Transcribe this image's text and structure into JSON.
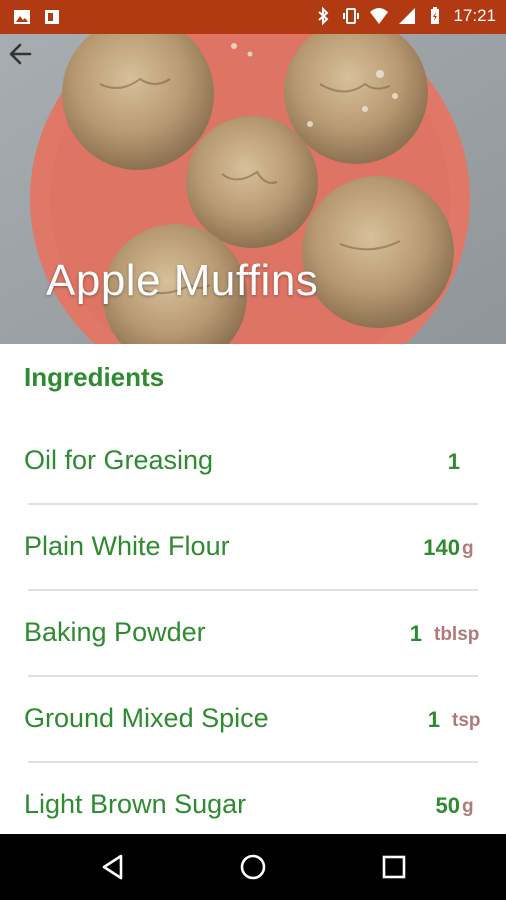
{
  "status_bar": {
    "time": "17:21",
    "left_icons": [
      "image-icon",
      "office-icon"
    ],
    "right_icons": [
      "bluetooth-icon",
      "vibrate-icon",
      "wifi-icon",
      "signal-icon",
      "battery-charging-icon"
    ]
  },
  "header": {
    "title": "Apple Muffins",
    "back_icon": "arrow-back-icon"
  },
  "ingredients": {
    "section_title": "Ingredients",
    "items": [
      {
        "name": "Oil for Greasing",
        "qty": "1",
        "unit": ""
      },
      {
        "name": "Plain White Flour",
        "qty": "140",
        "unit": "g"
      },
      {
        "name": "Baking Powder",
        "qty": "1",
        "unit": "tblsp"
      },
      {
        "name": "Ground Mixed Spice",
        "qty": "1",
        "unit": "tsp"
      },
      {
        "name": "Light Brown Sugar",
        "qty": "50",
        "unit": "g"
      }
    ]
  },
  "nav_bar": {
    "buttons": [
      "back-triangle-icon",
      "home-circle-icon",
      "recents-square-icon"
    ]
  },
  "colors": {
    "status_bar": "#b23a12",
    "accent_green": "#2e8b2f",
    "unit_color": "#b07a7a",
    "plate": "#e07868"
  }
}
